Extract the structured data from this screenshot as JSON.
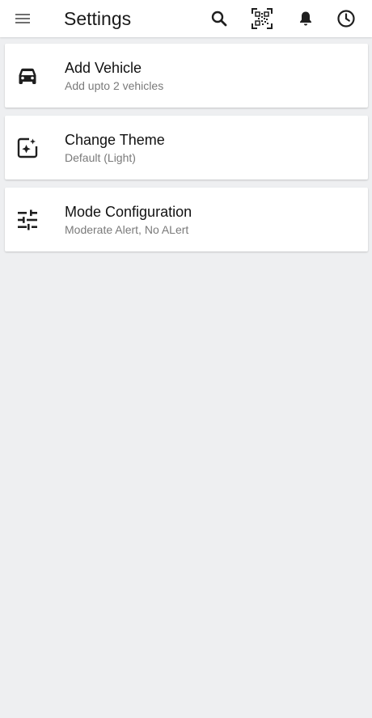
{
  "appbar": {
    "title": "Settings",
    "menu_icon": "hamburger-menu-icon",
    "actions": [
      "search-icon",
      "qr-code-icon",
      "bell-icon",
      "clock-icon"
    ]
  },
  "settings": [
    {
      "icon": "car-icon",
      "title": "Add Vehicle",
      "subtitle": "Add upto 2 vehicles"
    },
    {
      "icon": "theme-sparkle-icon",
      "title": "Change Theme",
      "subtitle": "Default (Light)"
    },
    {
      "icon": "tune-sliders-icon",
      "title": "Mode Configuration",
      "subtitle": "Moderate Alert, No ALert"
    }
  ],
  "colors": {
    "background": "#eeeff1",
    "card": "#ffffff",
    "title_text": "#1a1a1a",
    "subtitle_text": "#7a7a7a",
    "icon": "#222222"
  }
}
